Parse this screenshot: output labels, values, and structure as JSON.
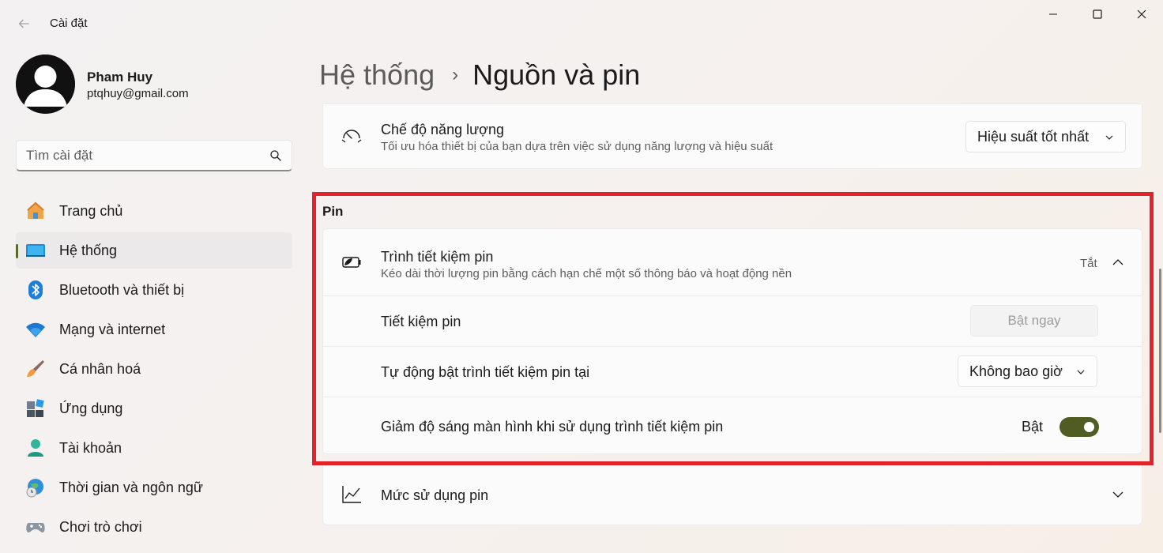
{
  "window": {
    "title": "Cài đặt"
  },
  "profile": {
    "name": "Pham Huy",
    "email": "ptqhuy@gmail.com"
  },
  "search": {
    "placeholder": "Tìm cài đặt"
  },
  "nav": {
    "items": [
      {
        "label": "Trang chủ",
        "icon": "home-icon",
        "active": false
      },
      {
        "label": "Hệ thống",
        "icon": "system-icon",
        "active": true
      },
      {
        "label": "Bluetooth và thiết bị",
        "icon": "bluetooth-icon",
        "active": false
      },
      {
        "label": "Mạng và internet",
        "icon": "wifi-icon",
        "active": false
      },
      {
        "label": "Cá nhân hoá",
        "icon": "brush-icon",
        "active": false
      },
      {
        "label": "Ứng dụng",
        "icon": "apps-icon",
        "active": false
      },
      {
        "label": "Tài khoản",
        "icon": "account-icon",
        "active": false
      },
      {
        "label": "Thời gian và ngôn ngữ",
        "icon": "time-language-icon",
        "active": false
      },
      {
        "label": "Chơi trò chơi",
        "icon": "gaming-icon",
        "active": false
      }
    ]
  },
  "breadcrumb": {
    "parent": "Hệ thống",
    "separator": "›",
    "current": "Nguồn và pin"
  },
  "power_mode": {
    "title": "Chế độ năng lượng",
    "description": "Tối ưu hóa thiết bị của bạn dựa trên việc sử dụng năng lượng và hiệu suất",
    "value": "Hiệu suất tốt nhất"
  },
  "battery": {
    "section_label": "Pin",
    "saver": {
      "title": "Trình tiết kiệm pin",
      "description": "Kéo dài thời lượng pin bằng cách hạn chế một số thông báo và hoạt động nền",
      "status": "Tắt"
    },
    "saver_now": {
      "label": "Tiết kiệm pin",
      "button": "Bật ngay"
    },
    "auto_on": {
      "label": "Tự động bật trình tiết kiệm pin tại",
      "value": "Không bao giờ"
    },
    "dim_screen": {
      "label": "Giảm độ sáng màn hình khi sử dụng trình tiết kiệm pin",
      "state_label": "Bật",
      "on": true
    },
    "usage": {
      "title": "Mức sử dụng pin"
    }
  },
  "colors": {
    "accent": "#4f5d22",
    "highlight": "#e3232c"
  }
}
